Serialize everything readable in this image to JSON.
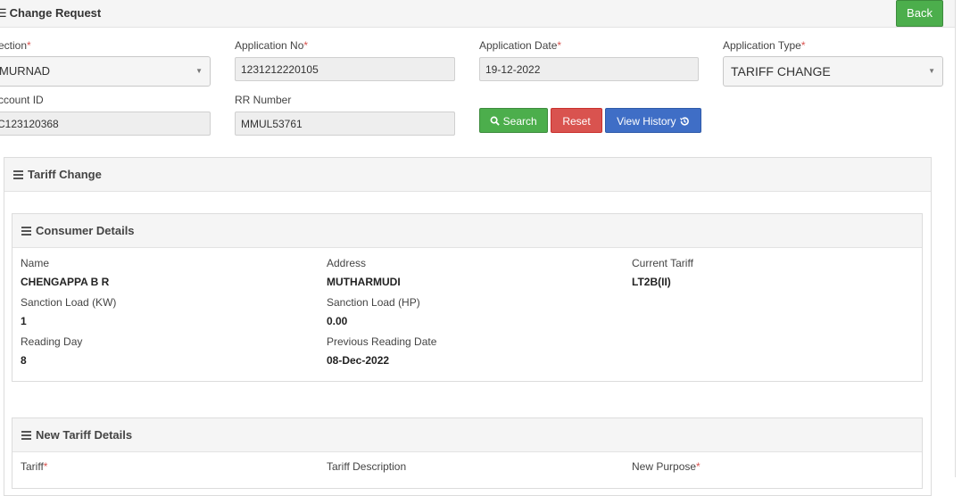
{
  "header": {
    "title": "Change Request",
    "back_label": "Back"
  },
  "form": {
    "section": {
      "label": "ection",
      "value": "MURNAD"
    },
    "application_no": {
      "label": "Application No",
      "value": "1231212220105"
    },
    "application_date": {
      "label": "Application Date",
      "value": "19-12-2022"
    },
    "application_type": {
      "label": "Application Type",
      "value": "TARIFF CHANGE"
    },
    "account_id": {
      "label": "ccount ID",
      "value": "C123120368"
    },
    "rr_number": {
      "label": "RR Number",
      "value": "MMUL53761"
    },
    "required_mark": "*"
  },
  "buttons": {
    "search": "Search",
    "reset": "Reset",
    "view_history": "View History"
  },
  "tariff_change": {
    "title": "Tariff Change"
  },
  "consumer_details": {
    "title": "Consumer Details",
    "name": {
      "label": "Name",
      "value": "CHENGAPPA B R"
    },
    "address": {
      "label": "Address",
      "value": "MUTHARMUDI"
    },
    "current_tariff": {
      "label": "Current Tariff",
      "value": "LT2B(II)"
    },
    "sanction_kw": {
      "label": "Sanction Load (KW)",
      "value": "1"
    },
    "sanction_hp": {
      "label": "Sanction Load (HP)",
      "value": "0.00"
    },
    "reading_day": {
      "label": "Reading Day",
      "value": "8"
    },
    "prev_reading_date": {
      "label": "Previous Reading Date",
      "value": "08-Dec-2022"
    }
  },
  "new_tariff": {
    "title": "New Tariff Details",
    "tariff_label": "Tariff",
    "tariff_desc_label": "Tariff Description",
    "new_purpose_label": "New Purpose"
  },
  "colors": {
    "green": "#4cae4c",
    "red": "#d9534f",
    "blue": "#3f6ec6"
  }
}
